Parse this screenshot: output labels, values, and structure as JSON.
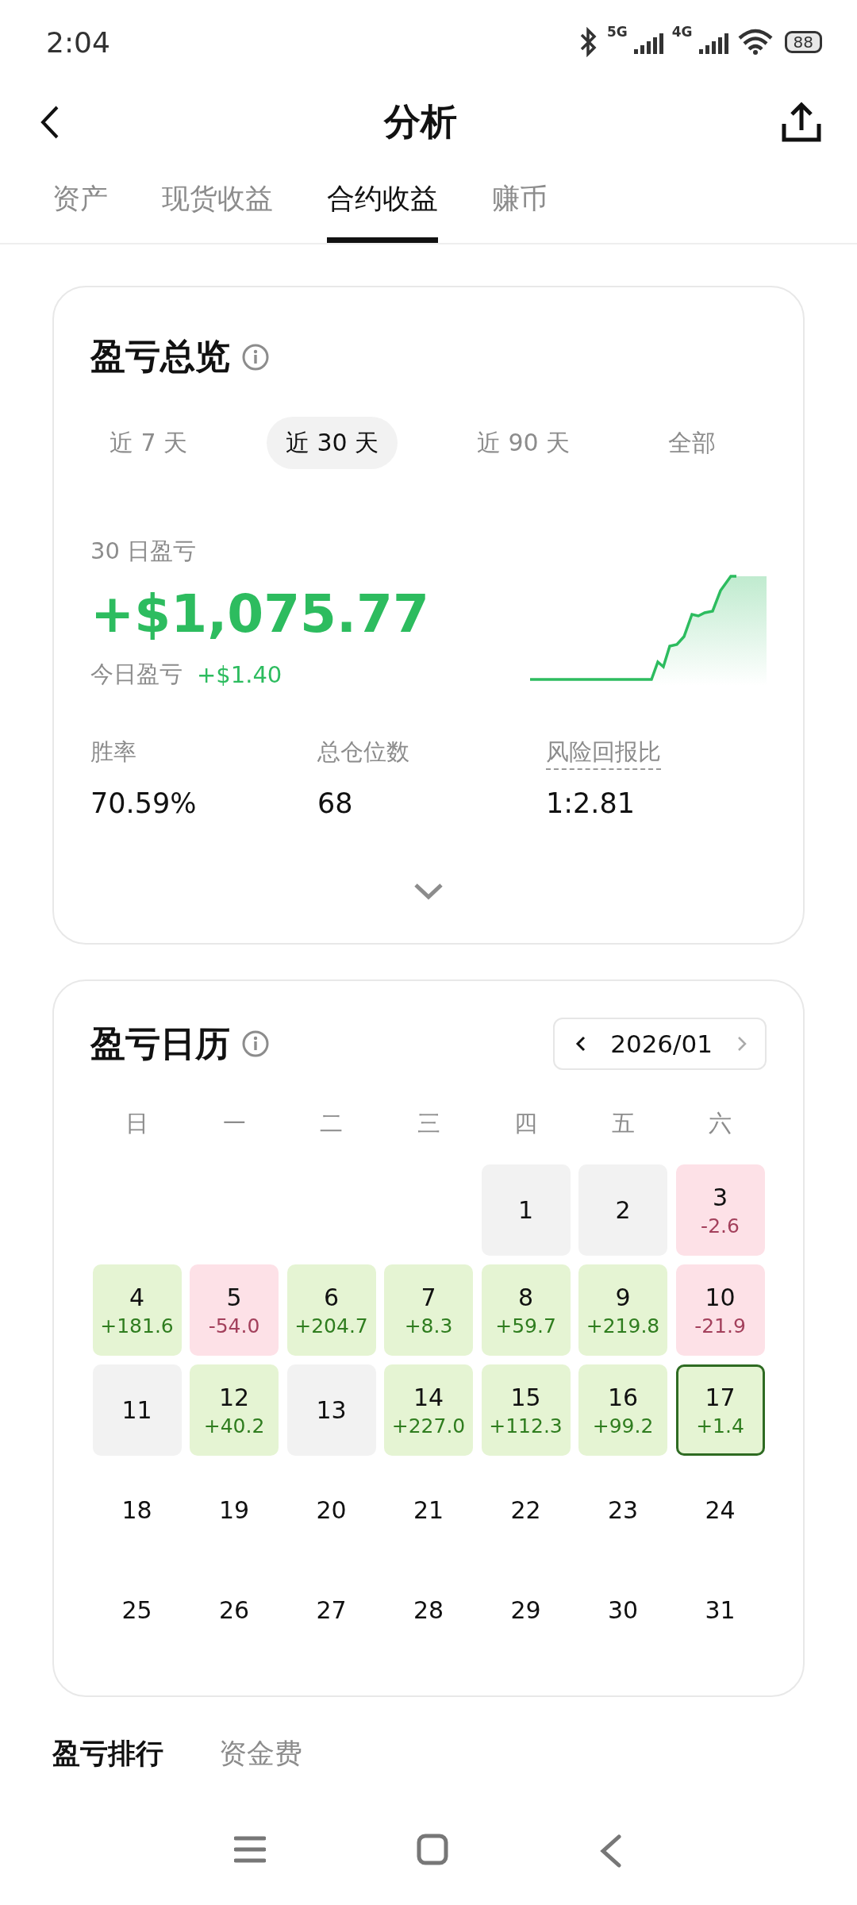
{
  "status_bar": {
    "time": "2:04",
    "network_1": "5G",
    "network_2": "4G",
    "battery": "88"
  },
  "header": {
    "title": "分析"
  },
  "tabs": [
    {
      "label": "资产",
      "selected": false
    },
    {
      "label": "现货收益",
      "selected": false
    },
    {
      "label": "合约收益",
      "selected": true
    },
    {
      "label": "赚币",
      "selected": false
    }
  ],
  "overview": {
    "title": "盈亏总览",
    "periods": [
      {
        "label": "近 7 天",
        "selected": false
      },
      {
        "label": "近 30 天",
        "selected": true
      },
      {
        "label": "近 90 天",
        "selected": false
      },
      {
        "label": "全部",
        "selected": false
      }
    ],
    "pnl_label": "30 日盈亏",
    "pnl_value": "+$1,075.77",
    "today_label": "今日盈亏",
    "today_value": "+$1.40",
    "stats": [
      {
        "label": "胜率",
        "value": "70.59%",
        "has_tooltip": false
      },
      {
        "label": "总仓位数",
        "value": "68",
        "has_tooltip": false
      },
      {
        "label": "风险回报比",
        "value": "1:2.81",
        "has_tooltip": true
      }
    ]
  },
  "calendar": {
    "title": "盈亏日历",
    "month": "2026/01",
    "weekdays": [
      "日",
      "一",
      "二",
      "三",
      "四",
      "五",
      "六"
    ],
    "weeks": [
      [
        {
          "kind": "empty"
        },
        {
          "kind": "empty"
        },
        {
          "kind": "empty"
        },
        {
          "kind": "empty"
        },
        {
          "kind": "flat",
          "day": "1",
          "selected": false
        },
        {
          "kind": "flat",
          "day": "2",
          "selected": false
        },
        {
          "kind": "loss",
          "day": "3",
          "value": "-2.6",
          "selected": false
        }
      ],
      [
        {
          "kind": "profit",
          "day": "4",
          "value": "+181.6",
          "selected": false
        },
        {
          "kind": "loss",
          "day": "5",
          "value": "-54.0",
          "selected": false
        },
        {
          "kind": "profit",
          "day": "6",
          "value": "+204.7",
          "selected": false
        },
        {
          "kind": "profit",
          "day": "7",
          "value": "+8.3",
          "selected": false
        },
        {
          "kind": "profit",
          "day": "8",
          "value": "+59.7",
          "selected": false
        },
        {
          "kind": "profit",
          "day": "9",
          "value": "+219.8",
          "selected": false
        },
        {
          "kind": "loss",
          "day": "10",
          "value": "-21.9",
          "selected": false
        }
      ],
      [
        {
          "kind": "flat",
          "day": "11",
          "selected": false
        },
        {
          "kind": "profit",
          "day": "12",
          "value": "+40.2",
          "selected": false
        },
        {
          "kind": "flat",
          "day": "13",
          "selected": false
        },
        {
          "kind": "profit",
          "day": "14",
          "value": "+227.0",
          "selected": false
        },
        {
          "kind": "profit",
          "day": "15",
          "value": "+112.3",
          "selected": false
        },
        {
          "kind": "profit",
          "day": "16",
          "value": "+99.2",
          "selected": false
        },
        {
          "kind": "profit",
          "day": "17",
          "value": "+1.4",
          "selected": true
        }
      ],
      [
        {
          "kind": "future",
          "day": "18"
        },
        {
          "kind": "future",
          "day": "19"
        },
        {
          "kind": "future",
          "day": "20"
        },
        {
          "kind": "future",
          "day": "21"
        },
        {
          "kind": "future",
          "day": "22"
        },
        {
          "kind": "future",
          "day": "23"
        },
        {
          "kind": "future",
          "day": "24"
        }
      ],
      [
        {
          "kind": "future",
          "day": "25"
        },
        {
          "kind": "future",
          "day": "26"
        },
        {
          "kind": "future",
          "day": "27"
        },
        {
          "kind": "future",
          "day": "28"
        },
        {
          "kind": "future",
          "day": "29"
        },
        {
          "kind": "future",
          "day": "30"
        },
        {
          "kind": "future",
          "day": "31"
        }
      ]
    ]
  },
  "bottom_tabs": [
    {
      "label": "盈亏排行",
      "selected": true
    },
    {
      "label": "资金费",
      "selected": false
    }
  ]
}
